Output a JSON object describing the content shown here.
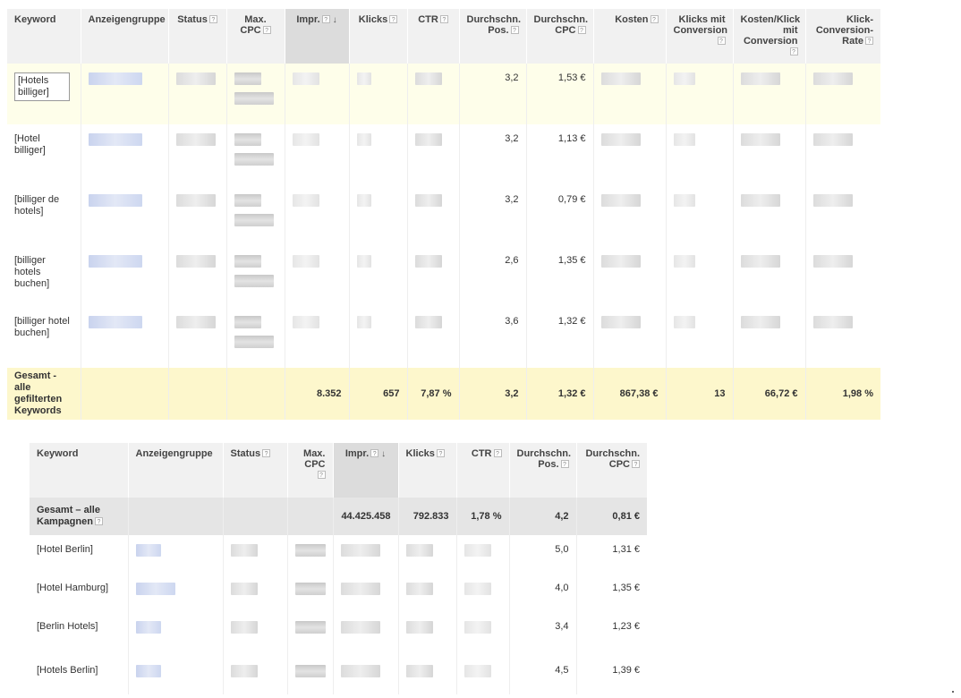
{
  "table1": {
    "headers": [
      {
        "label": "Keyword",
        "help": false,
        "sorted": false,
        "align": "l"
      },
      {
        "label": "Anzeigengruppe",
        "help": false,
        "sorted": false,
        "align": "l"
      },
      {
        "label": "Status",
        "help": true,
        "sorted": false,
        "align": "c"
      },
      {
        "label": "Max. CPC",
        "help": true,
        "sorted": false,
        "align": "c"
      },
      {
        "label": "Impr.",
        "help": true,
        "sorted": true,
        "align": "c"
      },
      {
        "label": "Klicks",
        "help": true,
        "sorted": false,
        "align": "c"
      },
      {
        "label": "CTR",
        "help": true,
        "sorted": false,
        "align": "c"
      },
      {
        "label": "Durchschn. Pos.",
        "help": true,
        "sorted": false,
        "align": "r"
      },
      {
        "label": "Durchschn. CPC",
        "help": true,
        "sorted": false,
        "align": "r"
      },
      {
        "label": "Kosten",
        "help": true,
        "sorted": false,
        "align": "r"
      },
      {
        "label": "Klicks mit Conversion",
        "help": true,
        "sorted": false,
        "align": "r"
      },
      {
        "label": "Kosten/Klick mit Conversion",
        "help": true,
        "sorted": false,
        "align": "r"
      },
      {
        "label": "Klick-Conversion-Rate",
        "help": true,
        "sorted": false,
        "align": "r"
      }
    ],
    "rows": [
      {
        "keyword": "[Hotels billiger]",
        "pos": "3,2",
        "cpc": "1,53 €",
        "selected": true
      },
      {
        "keyword": "[Hotel billiger]",
        "pos": "3,2",
        "cpc": "1,13 €",
        "selected": false
      },
      {
        "keyword": "[billiger de hotels]",
        "pos": "3,2",
        "cpc": "0,79 €",
        "selected": false
      },
      {
        "keyword": "[billiger hotels buchen]",
        "pos": "2,6",
        "cpc": "1,35 €",
        "selected": false
      },
      {
        "keyword": "[billiger hotel buchen]",
        "pos": "3,6",
        "cpc": "1,32 €",
        "selected": false
      }
    ],
    "total": {
      "label": "Gesamt - alle gefilterten Keywords",
      "impr": "8.352",
      "klicks": "657",
      "ctr": "7,87 %",
      "pos": "3,2",
      "cpc": "1,32 €",
      "kosten": "867,38 €",
      "conv": "13",
      "kosten_conv": "66,72 €",
      "rate": "1,98 %"
    }
  },
  "table2": {
    "headers": [
      {
        "label": "Keyword",
        "help": false,
        "sorted": false,
        "align": "l"
      },
      {
        "label": "Anzeigengruppe",
        "help": false,
        "sorted": false,
        "align": "l"
      },
      {
        "label": "Status",
        "help": true,
        "sorted": false,
        "align": "l"
      },
      {
        "label": "Max. CPC",
        "help": true,
        "sorted": false,
        "align": "r"
      },
      {
        "label": "Impr.",
        "help": true,
        "sorted": true,
        "align": "c"
      },
      {
        "label": "Klicks",
        "help": true,
        "sorted": false,
        "align": "l"
      },
      {
        "label": "CTR",
        "help": true,
        "sorted": false,
        "align": "r"
      },
      {
        "label": "Durchschn. Pos.",
        "help": true,
        "sorted": false,
        "align": "r"
      },
      {
        "label": "Durchschn. CPC",
        "help": true,
        "sorted": false,
        "align": "r"
      }
    ],
    "total": {
      "label": "Gesamt – alle Kampagnen",
      "impr": "44.425.458",
      "klicks": "792.833",
      "ctr": "1,78 %",
      "pos": "4,2",
      "cpc": "0,81 €"
    },
    "rows": [
      {
        "keyword": "[Hotel Berlin]",
        "pos": "5,0",
        "cpc": "1,31 €"
      },
      {
        "keyword": "[Hotel Hamburg]",
        "pos": "4,0",
        "cpc": "1,35 €"
      },
      {
        "keyword": "[Berlin Hotels]",
        "pos": "3,4",
        "cpc": "1,23 €"
      },
      {
        "keyword": "[Hotels Berlin]",
        "pos": "4,5",
        "cpc": "1,39 €"
      }
    ]
  },
  "help_glyph": "?",
  "sort_glyph": "↓"
}
